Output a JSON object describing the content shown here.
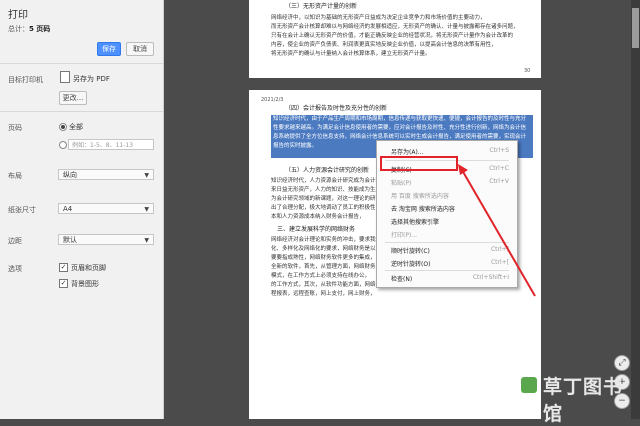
{
  "panel": {
    "title": "打印",
    "total_label": "总计：",
    "total_value": "5 页码",
    "print_button": "保存",
    "cancel_button": "取消",
    "destination_label": "目标打印机",
    "destination_value": "另存为 PDF",
    "change_button": "更改...",
    "pages_label": "页码",
    "pages_all": "全部",
    "pages_placeholder": "例如：1-5、8、11-13",
    "layout_label": "布局",
    "layout_value": "纵向",
    "paper_label": "纸张尺寸",
    "paper_value": "A4",
    "margins_label": "边距",
    "margins_value": "默认",
    "options_label": "选项",
    "option_headers": "页眉和页脚",
    "option_background": "背景图形"
  },
  "preview": {
    "page1_heading": "（三）无形资产计量的创新",
    "page1_lines": [
      "网络经济中，以知识为基础的无形资产日益成为决定企业竞争力和市场价值的主要动力，",
      "而无形资产会计核算却难以与网络经济的发展相适应，无形资产的确认、计量与披露都存在诸多问题，",
      "只有在会计上确认无形资产的价值，才能正确反映企业的经营状况，将无形资产计量作为会计改革的",
      "内容，使企业的资产负债表、利润表更真实地反映企业价值，以提高会计信息的决策有用性，",
      "将无形资产的确认与计量纳入会计核算体系，建立无形资产计量。"
    ],
    "page1_number": "30",
    "page2_header": "2021/2/3",
    "page2_heading": "（四）会计报告及时性及充分性的创新",
    "page2_highlight": "知识经济时代，由于产品生产周期和市场周期，信息传递与获取更快速、便捷，会计报告的及时性与充分性要求越来越高。为满足会计信息使用者的需要，应对会计报告及时性、充分性进行创新，网络为会计信息系统提供了全方位信息支持，网络会计信息系统可以实时生成会计报告，满足使用者的需要，实现会计报告的实时披露。",
    "page2_sub5": "（五）人力资源会计研究的创新",
    "page2_link_text": "会计研究",
    "page2_para2": [
      "知识经济时代，人力资源会计研究成为会计理论界研究的重点和热点，",
      "来日益无形资产，人力的知识、技能成为生产力的决定因素，",
      "为会计研究领域的新课题，对这一理论的研究，有利于",
      "出了合理分配，极大地调动了员工的积极性，",
      "本和人力资源成本纳入财务会计报告，"
    ],
    "page2_sub3": "三、建立发展科学的网络财务",
    "page2_para3": [
      "网络经济对会计理论和实务的冲击，要求我们积极研究网络财务，",
      "化、多样化及网络化的要求，网络财务是以网络为基础，",
      "要要指成熟性，网络财务软件更多的集成，",
      "全新的软件，首先，从管理方面，网络财务",
      "模式，在工作方式上必须支持在线办公，",
      "的工作方式，其次，从软件功能方面，网络财务",
      "程报表，远程查账，网上支付，网上财务，"
    ]
  },
  "context_menu": {
    "items": [
      {
        "label": "另存为(A)...",
        "shortcut": "Ctrl+S",
        "disabled": false
      },
      {
        "label": "复制(C)",
        "shortcut": "Ctrl+C",
        "disabled": false
      },
      {
        "label": "粘贴(P)",
        "shortcut": "Ctrl+V",
        "disabled": true
      },
      {
        "label": "用 百度 搜索所选内容",
        "shortcut": "",
        "disabled": true
      },
      {
        "label": "去 淘宝网 搜索所选内容",
        "shortcut": "",
        "disabled": false
      },
      {
        "label": "选择其他搜索引擎",
        "shortcut": "",
        "disabled": false
      },
      {
        "label": "打印(P)...",
        "shortcut": "",
        "disabled": true
      },
      {
        "label": "顺时针旋转(C)",
        "shortcut": "Ctrl+]",
        "disabled": false
      },
      {
        "label": "逆时针旋转(O)",
        "shortcut": "Ctrl+[",
        "disabled": false
      },
      {
        "label": "检查(N)",
        "shortcut": "Ctrl+Shift+I",
        "disabled": false
      }
    ]
  },
  "controls": {
    "fit_icon": "fit-page-icon",
    "zoom_in": "+",
    "zoom_out": "−"
  },
  "watermark": "草丁图书馆",
  "colors": {
    "highlight": "#2c63b6",
    "annotation_red": "#e0242a",
    "primary_button": "#4d90fe"
  }
}
